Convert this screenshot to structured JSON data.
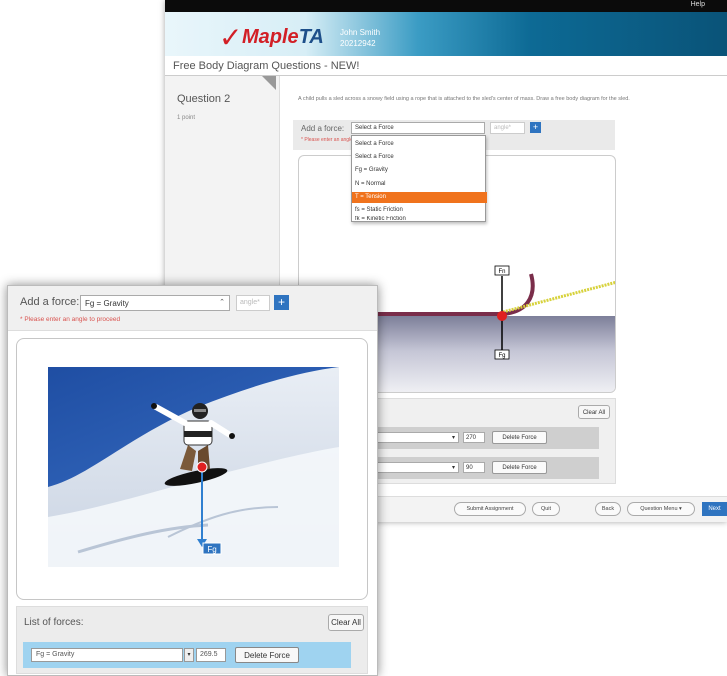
{
  "header": {
    "help_link": "Help",
    "logo_check": "✓",
    "logo_main": "Maple",
    "logo_ta": "TA",
    "user_name": "John Smith",
    "user_id": "20212942"
  },
  "back_window": {
    "page_title": "Free Body Diagram Questions - NEW!",
    "question_label": "Question 2",
    "question_points": "1 point",
    "question_text": "A child pulls a sled across a snowy field using a rope that is attached to the sled's center of mass. Draw a free body diagram for the sled.",
    "add_force_label": "Add a force:",
    "select_value": "Select a Force",
    "angle_placeholder": "angle*",
    "plus_label": "+",
    "error_text": "* Please enter an angle to proceed",
    "dropdown_options": [
      "Select a Force",
      "Select a Force",
      "Fg = Gravity",
      "N = Normal",
      "T = Tension",
      "fs = Static Friction",
      "fk = Kinetic Friction"
    ],
    "selected_option_index": 4,
    "vector_labels": [
      "Fn",
      "Fg"
    ],
    "clear_all": "Clear All",
    "force_rows": [
      {
        "angle": "270",
        "delete": "Delete Force"
      },
      {
        "angle": "90",
        "delete": "Delete Force"
      }
    ],
    "footer_buttons": {
      "submit": "Submit Assignment",
      "quit": "Quit",
      "back": "Back",
      "menu": "Question Menu ▾",
      "next": "Next"
    }
  },
  "front_window": {
    "add_force_label": "Add a force:",
    "select_value": "Fg = Gravity",
    "angle_placeholder": "angle*",
    "plus_label": "+",
    "error_text": "* Please enter an angle to proceed",
    "vector_label": "Fg",
    "list_label": "List of forces:",
    "clear_all": "Clear All",
    "force_row": {
      "select": "Fg = Gravity",
      "angle": "269.5",
      "delete": "Delete Force"
    }
  },
  "colors": {
    "accent_blue": "#2f74c0",
    "highlight_orange": "#f0731d",
    "vector_red": "#e02020",
    "row_blue": "#9fd3f0"
  }
}
